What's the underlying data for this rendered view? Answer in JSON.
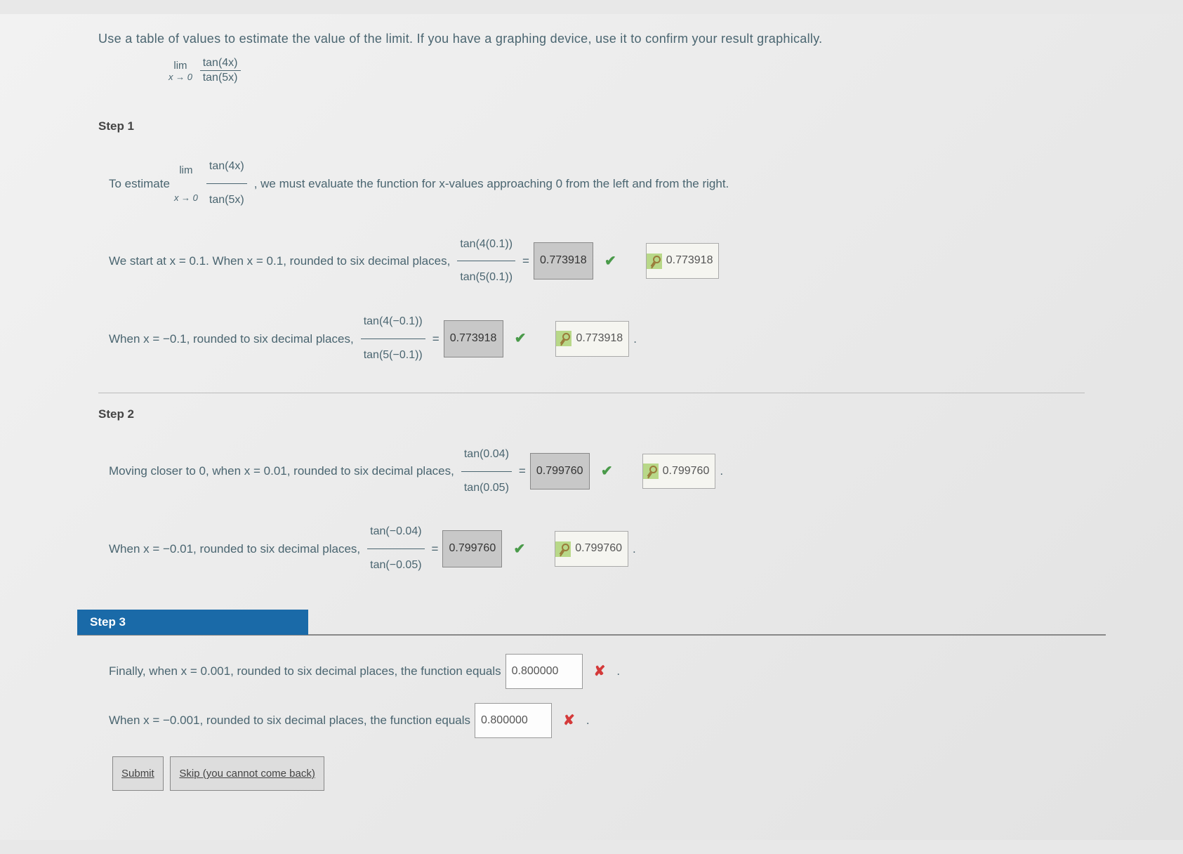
{
  "instruction": "Use a table of values to estimate the value of the limit. If you have a graphing device, use it to confirm your result graphically.",
  "limit": {
    "lim_label": "lim",
    "lim_sub": "x → 0",
    "numerator": "tan(4x)",
    "denominator": "tan(5x)"
  },
  "step1": {
    "heading": "Step 1",
    "intro_a": "To estimate ",
    "intro_b": ", we must evaluate the function for x-values approaching 0 from the left and from the right.",
    "line_a1": "We start at x = 0.1. When x = 0.1, rounded to six decimal places, ",
    "frac_a_num": "tan(4(0.1))",
    "frac_a_den": "tan(5(0.1))",
    "eq": " = ",
    "ans_a_box": "0.773918",
    "ans_a_key": "0.773918",
    "line_b1": "When x = −0.1, rounded to six decimal places, ",
    "frac_b_num": "tan(4(−0.1))",
    "frac_b_den": "tan(5(−0.1))",
    "ans_b_box": "0.773918",
    "ans_b_key": "0.773918"
  },
  "step2": {
    "heading": "Step 2",
    "line_a1": "Moving closer to 0, when x = 0.01, rounded to six decimal places, ",
    "frac_a_num": "tan(0.04)",
    "frac_a_den": "tan(0.05)",
    "eq": " = ",
    "ans_a_box": "0.799760",
    "ans_a_key": "0.799760",
    "line_b1": "When x = −0.01, rounded to six decimal places, ",
    "frac_b_num": "tan(−0.04)",
    "frac_b_den": "tan(−0.05)",
    "ans_b_box": "0.799760",
    "ans_b_key": "0.799760"
  },
  "step3": {
    "heading": "Step 3",
    "line_a1": "Finally, when x = 0.001, rounded to six decimal places, the function equals ",
    "ans_a": "0.800000",
    "line_b1": "When x = −0.001, rounded to six decimal places, the function equals ",
    "ans_b": "0.800000",
    "period": "."
  },
  "buttons": {
    "submit": "Submit",
    "skip": "Skip (you cannot come back)"
  },
  "icons": {
    "check": "✔",
    "cross": "✘"
  }
}
